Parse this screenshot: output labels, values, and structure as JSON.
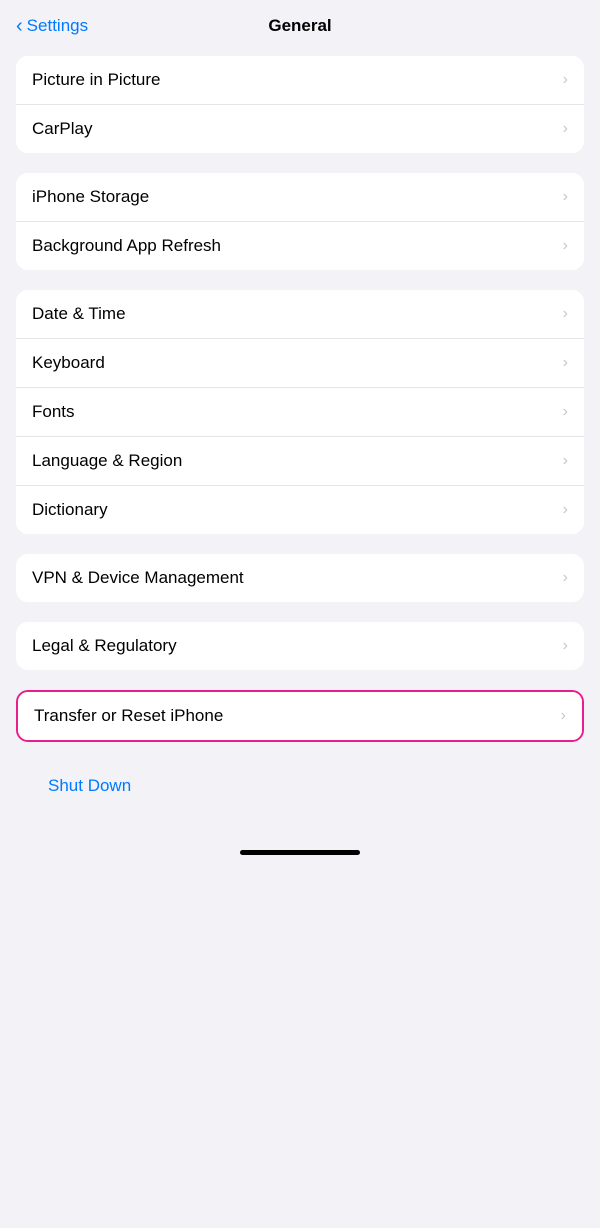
{
  "header": {
    "back_label": "Settings",
    "title": "General"
  },
  "groups": [
    {
      "id": "group1",
      "items": [
        {
          "id": "picture-in-picture",
          "label": "Picture in Picture"
        },
        {
          "id": "carplay",
          "label": "CarPlay"
        }
      ]
    },
    {
      "id": "group2",
      "items": [
        {
          "id": "iphone-storage",
          "label": "iPhone Storage"
        },
        {
          "id": "background-app-refresh",
          "label": "Background App Refresh"
        }
      ]
    },
    {
      "id": "group3",
      "items": [
        {
          "id": "date-time",
          "label": "Date & Time"
        },
        {
          "id": "keyboard",
          "label": "Keyboard"
        },
        {
          "id": "fonts",
          "label": "Fonts"
        },
        {
          "id": "language-region",
          "label": "Language & Region"
        },
        {
          "id": "dictionary",
          "label": "Dictionary"
        }
      ]
    },
    {
      "id": "group4",
      "items": [
        {
          "id": "vpn-device-management",
          "label": "VPN & Device Management"
        }
      ]
    },
    {
      "id": "group5",
      "items": [
        {
          "id": "legal-regulatory",
          "label": "Legal & Regulatory"
        }
      ]
    }
  ],
  "highlighted_item": {
    "label": "Transfer or Reset iPhone"
  },
  "shut_down": {
    "label": "Shut Down"
  },
  "chevron": "›"
}
